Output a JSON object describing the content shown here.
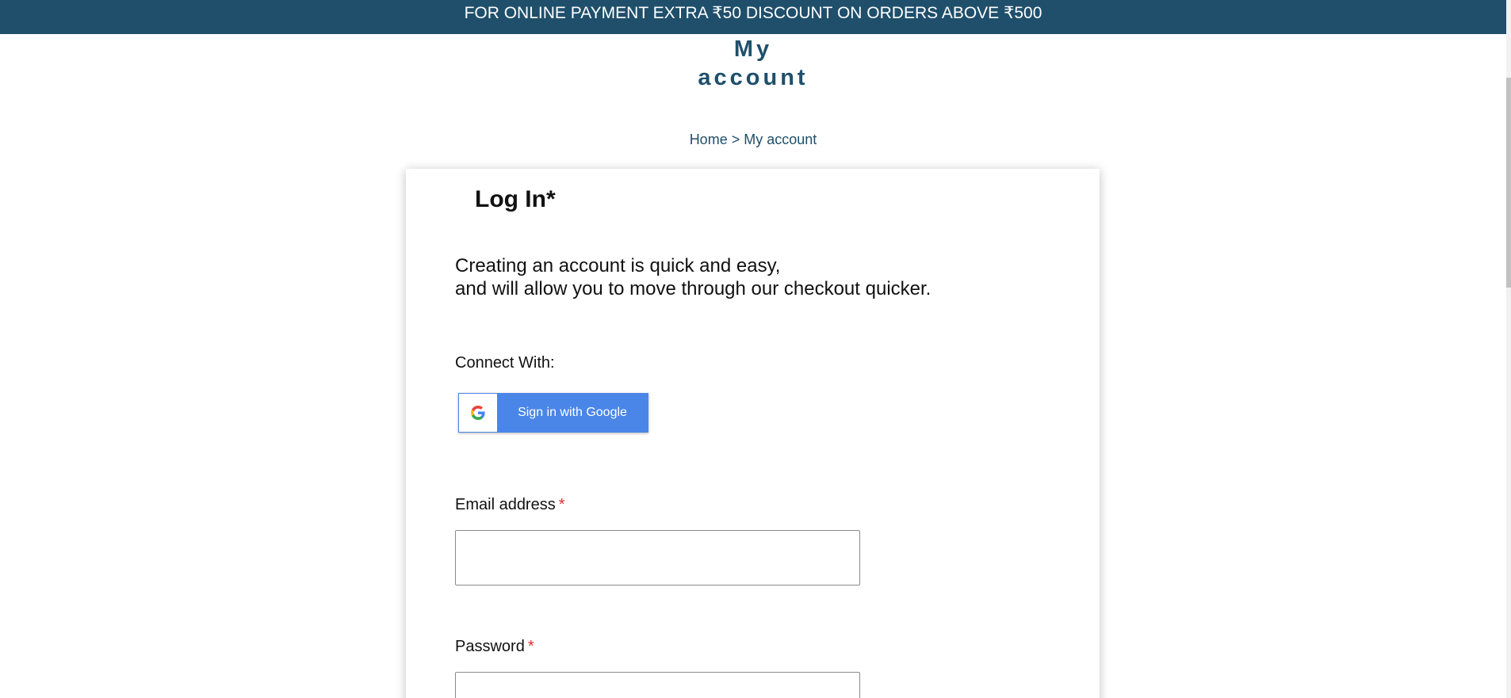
{
  "promo": {
    "text": "FOR ONLINE PAYMENT EXTRA ₹50 DISCOUNT ON ORDERS ABOVE ₹500"
  },
  "page": {
    "title_line1": "My",
    "title_line2": "account"
  },
  "breadcrumb": {
    "home": "Home",
    "separator": ">",
    "current": "My account"
  },
  "login": {
    "title": "Log In*",
    "intro_line1": "Creating an account is quick and easy,",
    "intro_line2": "and will allow you to move through our checkout quicker.",
    "connect_label": "Connect With:",
    "google_button": {
      "label": "Sign in with Google",
      "icon": "google-g-icon"
    },
    "email": {
      "label": "Email address",
      "required_marker": "*",
      "value": "",
      "placeholder": ""
    },
    "password": {
      "label": "Password",
      "required_marker": "*",
      "value": "",
      "placeholder": ""
    }
  },
  "colors": {
    "brand": "#1f4f6b",
    "google_blue": "#4a86e8",
    "required": "#e02b2b"
  }
}
